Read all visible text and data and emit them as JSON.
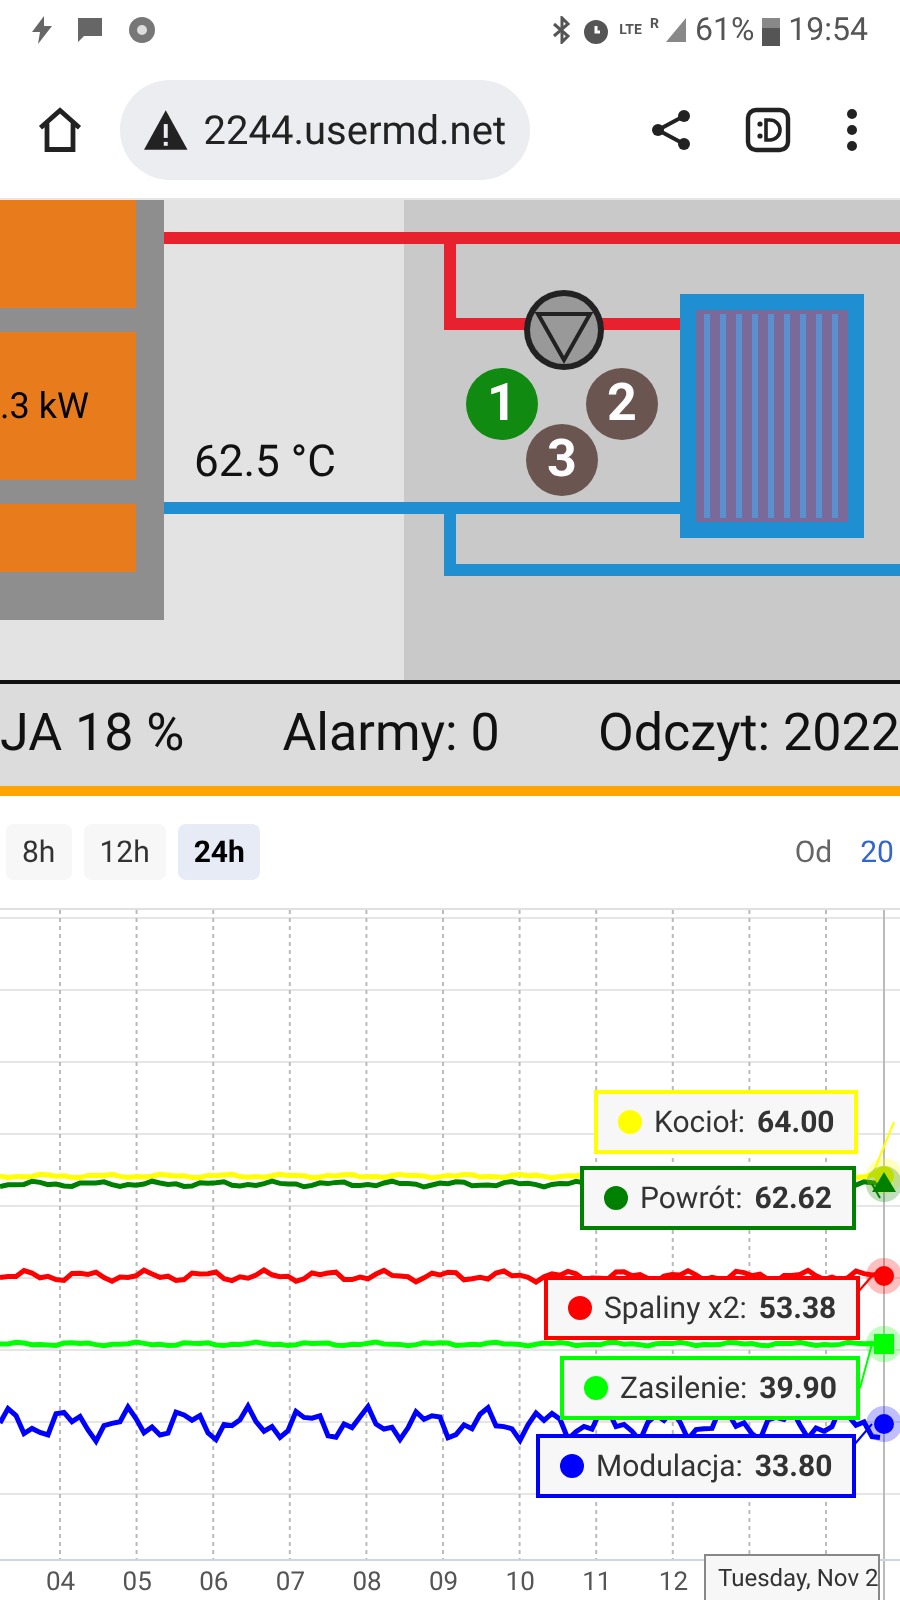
{
  "status_bar": {
    "indicators": [
      "LTE",
      "R"
    ],
    "battery": "61%",
    "time": "19:54"
  },
  "browser": {
    "url": "2244.usermd.net"
  },
  "diagram": {
    "power": ".3 kW",
    "temperature": "62.5 °C",
    "pumps": [
      {
        "label": "1",
        "active": true
      },
      {
        "label": "2",
        "active": false
      },
      {
        "label": "3",
        "active": false
      }
    ]
  },
  "info_bar": [
    "JA 18 %",
    "Alarmy: 0",
    "Odczyt: 2022"
  ],
  "range_buttons": [
    {
      "label": "8h",
      "selected": false
    },
    {
      "label": "12h",
      "selected": false
    },
    {
      "label": "24h",
      "selected": true
    }
  ],
  "from": {
    "label": "Od",
    "value": "20"
  },
  "chart": {
    "x_labels": [
      "04",
      "05",
      "06",
      "07",
      "08",
      "09",
      "10",
      "11",
      "12"
    ],
    "series": [
      {
        "name": "Kocioł:",
        "value": "64.00",
        "color": "#ffff00",
        "kind": "circle"
      },
      {
        "name": "Powrót:",
        "value": "62.62",
        "color": "#008000",
        "kind": "triangle"
      },
      {
        "name": "Spaliny x2:",
        "value": "53.38",
        "color": "#ff0000",
        "kind": "circle"
      },
      {
        "name": "Zasilenie:",
        "value": "39.90",
        "color": "#00ff00",
        "kind": "square"
      },
      {
        "name": "Modulacja:",
        "value": "33.80",
        "color": "#0000ff",
        "kind": "circle"
      }
    ],
    "tooltip_date": "Tuesday, Nov 2"
  }
}
